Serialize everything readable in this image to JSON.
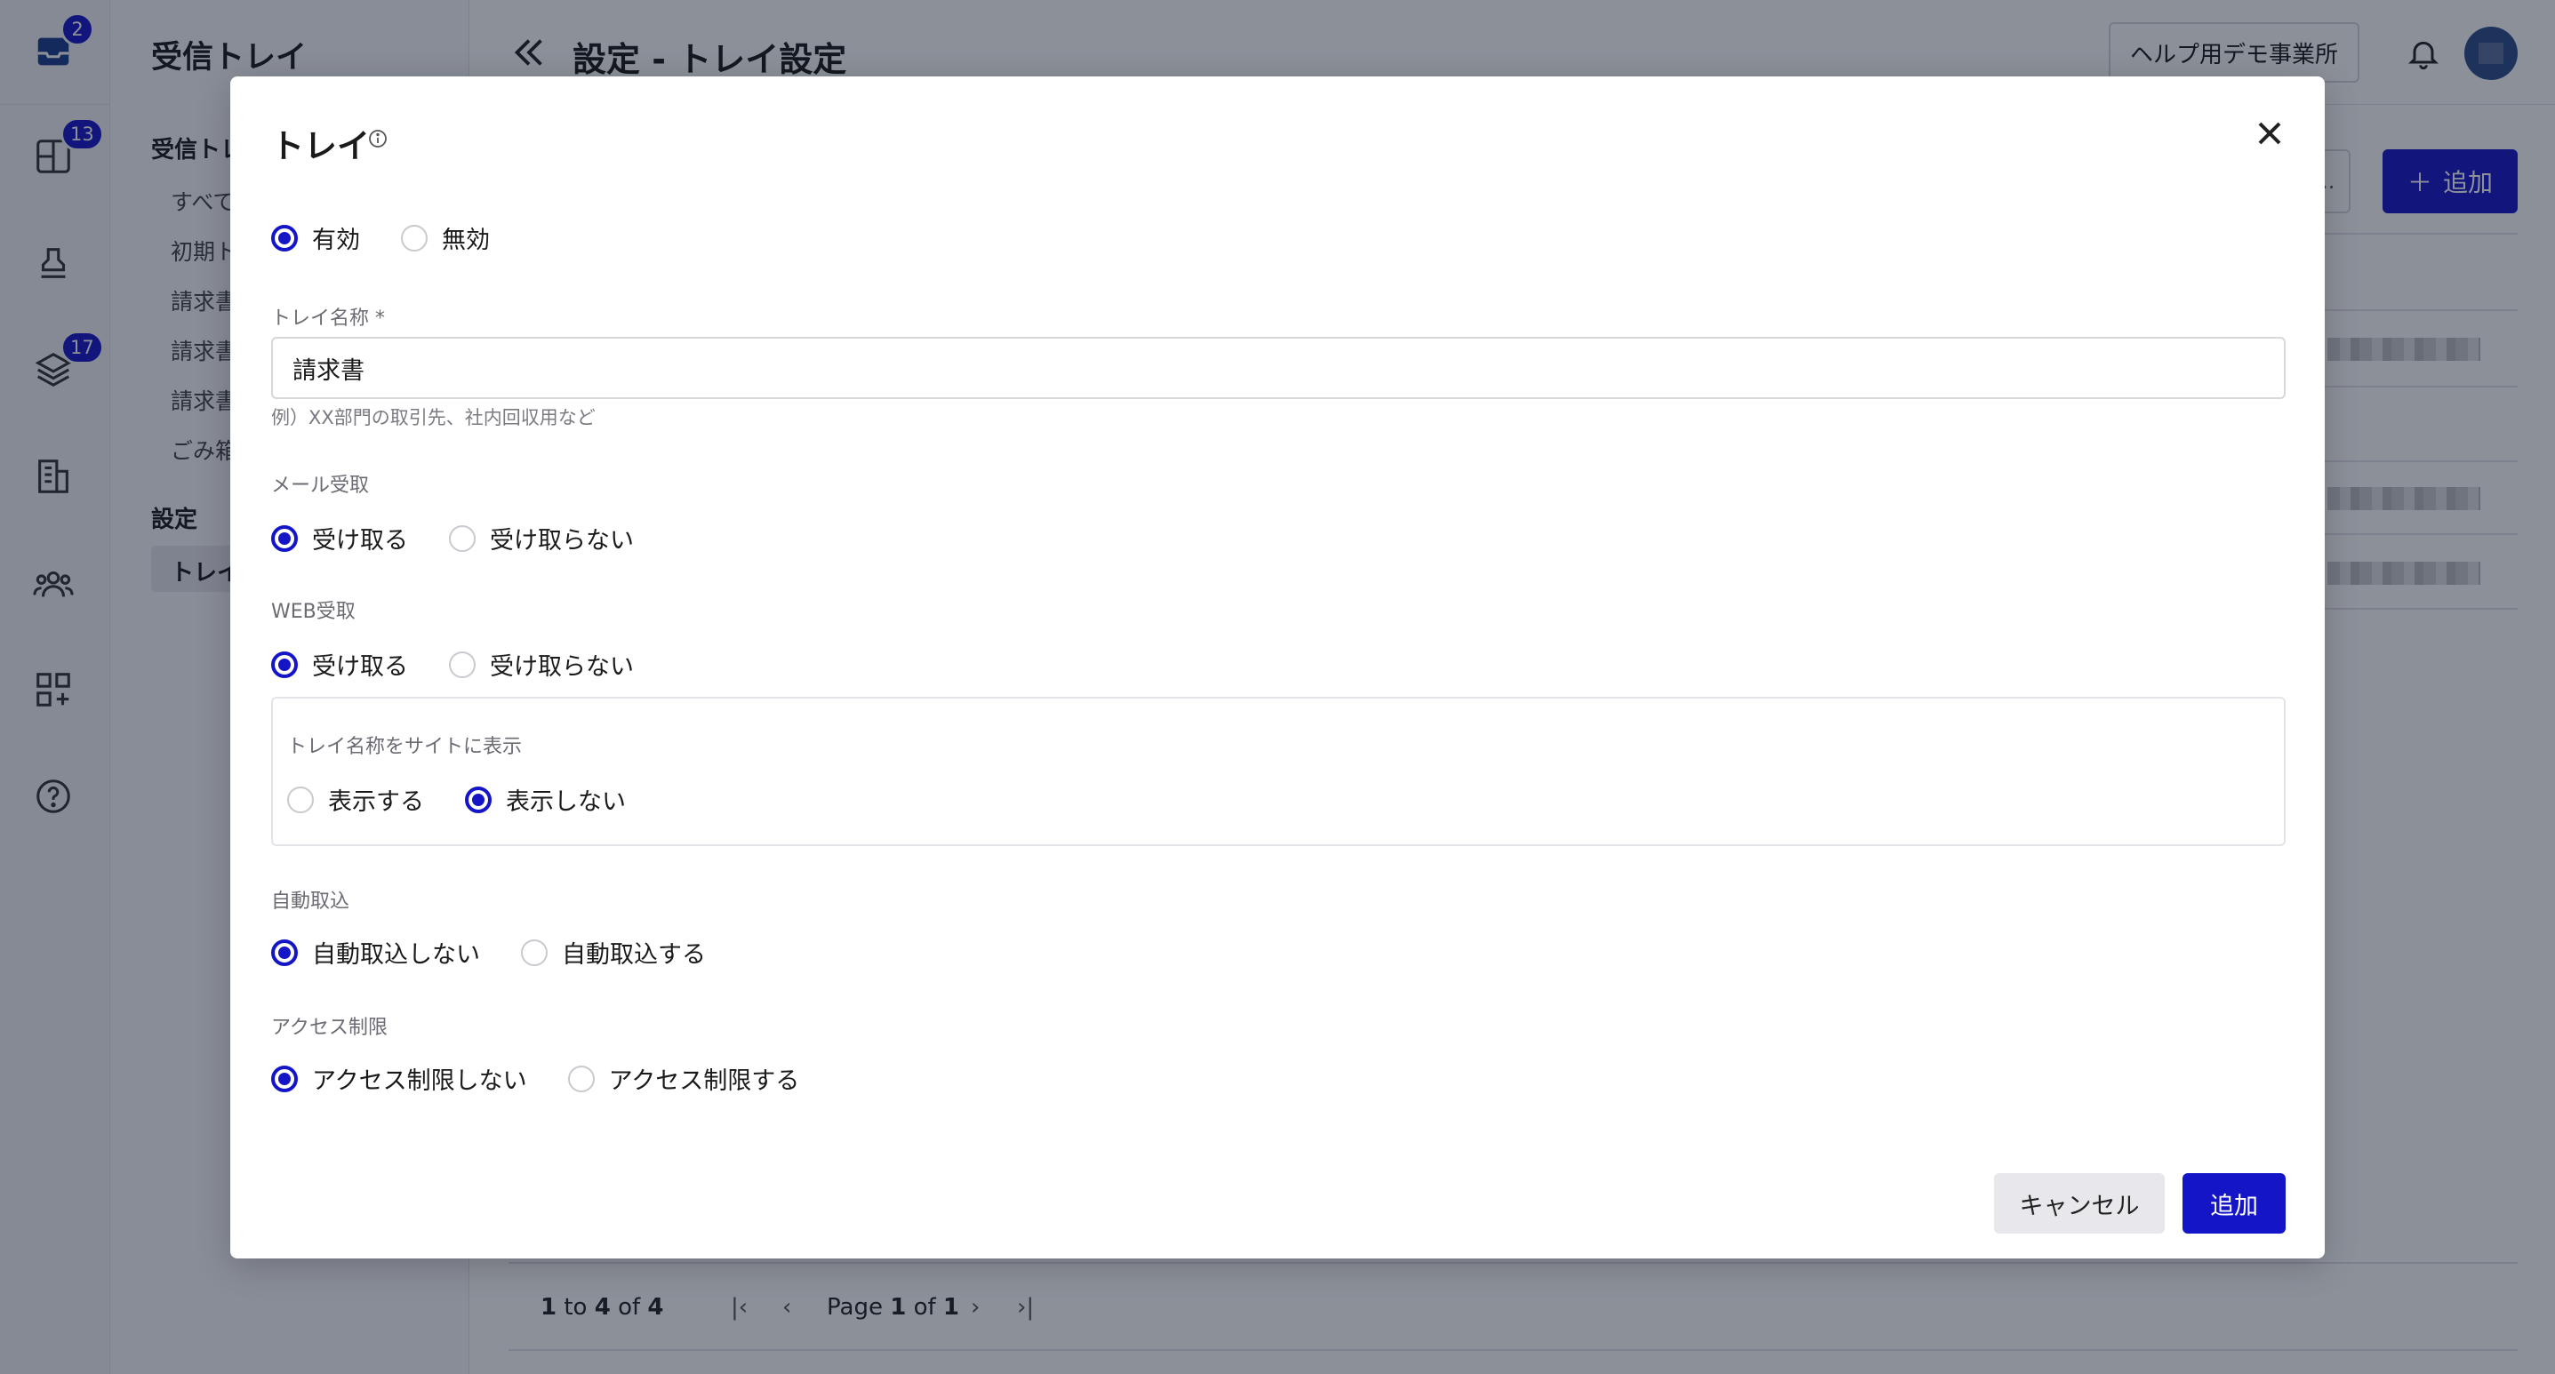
{
  "rail": {
    "badges": {
      "inbox": "2",
      "dashboard": "13",
      "layers": "17"
    }
  },
  "subnav": {
    "title": "受信トレイ",
    "group_inbox": "受信トレ",
    "items": [
      "すべて",
      "初期ト",
      "請求書",
      "請求書",
      "請求書",
      "ごみ箱"
    ],
    "group_settings": "設定",
    "active_item": "トレイ"
  },
  "header": {
    "title": "設定 - トレイ設定",
    "org": "ヘルプ用デモ事業所",
    "filter_label": "...",
    "add_label": "追加"
  },
  "pagination": {
    "from": "1",
    "to_word": "to",
    "to": "4",
    "of_word": "of",
    "total": "4",
    "page_word": "Page",
    "page": "1",
    "page_of_word": "of",
    "pages": "1"
  },
  "modal": {
    "title": "トレイ",
    "status": {
      "enabled": "有効",
      "disabled": "無効",
      "selected": "enabled"
    },
    "name": {
      "label": "トレイ名称 *",
      "value": "請求書",
      "hint": "例）XX部門の取引先、社内回収用など"
    },
    "mail": {
      "label": "メール受取",
      "yes": "受け取る",
      "no": "受け取らない",
      "selected": "yes"
    },
    "web": {
      "label": "WEB受取",
      "yes": "受け取る",
      "no": "受け取らない",
      "selected": "yes",
      "display": {
        "label": "トレイ名称をサイトに表示",
        "show": "表示する",
        "hide": "表示しない",
        "selected": "hide"
      }
    },
    "auto": {
      "label": "自動取込",
      "off": "自動取込しない",
      "on": "自動取込する",
      "selected": "off"
    },
    "access": {
      "label": "アクセス制限",
      "off": "アクセス制限しない",
      "on": "アクセス制限する",
      "selected": "off"
    },
    "cancel_label": "キャンセル",
    "submit_label": "追加"
  },
  "colors": {
    "accent": "#1515c8",
    "overlay": "#0f172a"
  }
}
